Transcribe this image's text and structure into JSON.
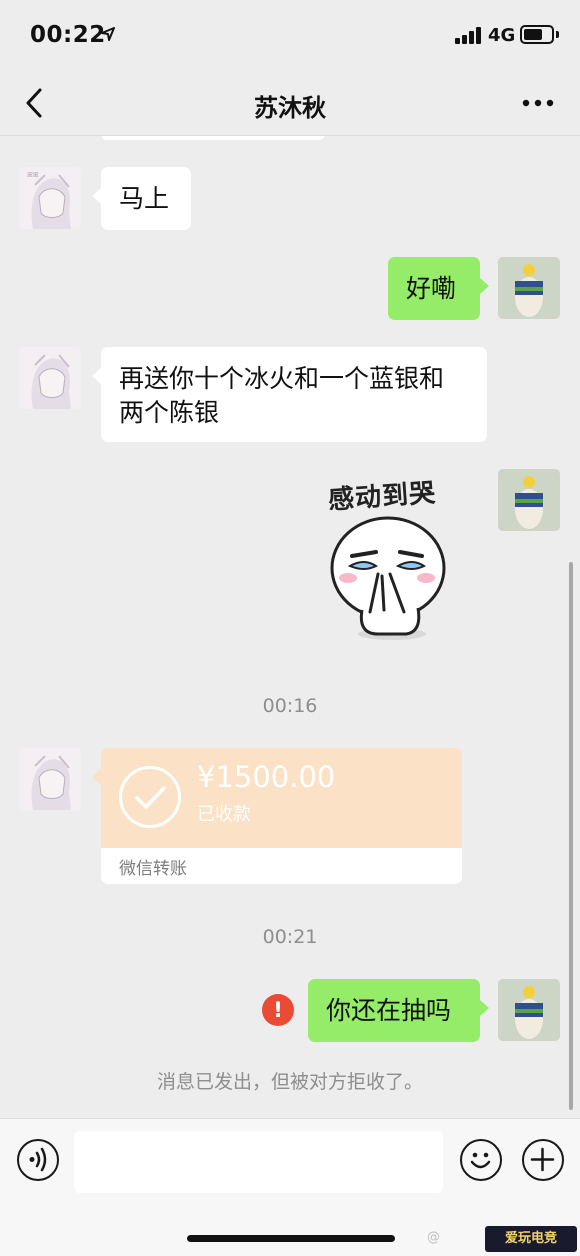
{
  "status_bar": {
    "time": "00:22",
    "network": "4G"
  },
  "nav": {
    "title": "苏沐秋",
    "back_icon": "chevron-left-icon",
    "more_icon": "more-dots-icon"
  },
  "messages": [
    {
      "from": "contact",
      "type": "text",
      "text": "马上"
    },
    {
      "from": "self",
      "type": "text",
      "text": "好嘞"
    },
    {
      "from": "contact",
      "type": "text",
      "lines": [
        "再送你十个冰火和一个蓝银和",
        "两个陈银"
      ]
    },
    {
      "from": "self",
      "type": "sticker",
      "caption": "感动到哭"
    },
    {
      "type": "timestamp",
      "text": "00:16"
    },
    {
      "from": "contact",
      "type": "transfer",
      "amount": "¥1500.00",
      "status": "已收款",
      "label": "微信转账"
    },
    {
      "type": "timestamp",
      "text": "00:21"
    },
    {
      "from": "self",
      "type": "text",
      "text": "你还在抽吗",
      "error_mark": "!"
    },
    {
      "type": "system",
      "text": "消息已发出，但被对方拒收了。"
    }
  ],
  "input_bar": {
    "placeholder": "",
    "icons": [
      "voice-icon",
      "emoji-icon",
      "plus-icon"
    ]
  },
  "colors": {
    "background": "#ededed",
    "incoming_bubble": "#ffffff",
    "outgoing_bubble": "#95ec69",
    "transfer_card": "#fbe1c5",
    "error": "#e94b35"
  },
  "watermark": "爱玩电竞"
}
